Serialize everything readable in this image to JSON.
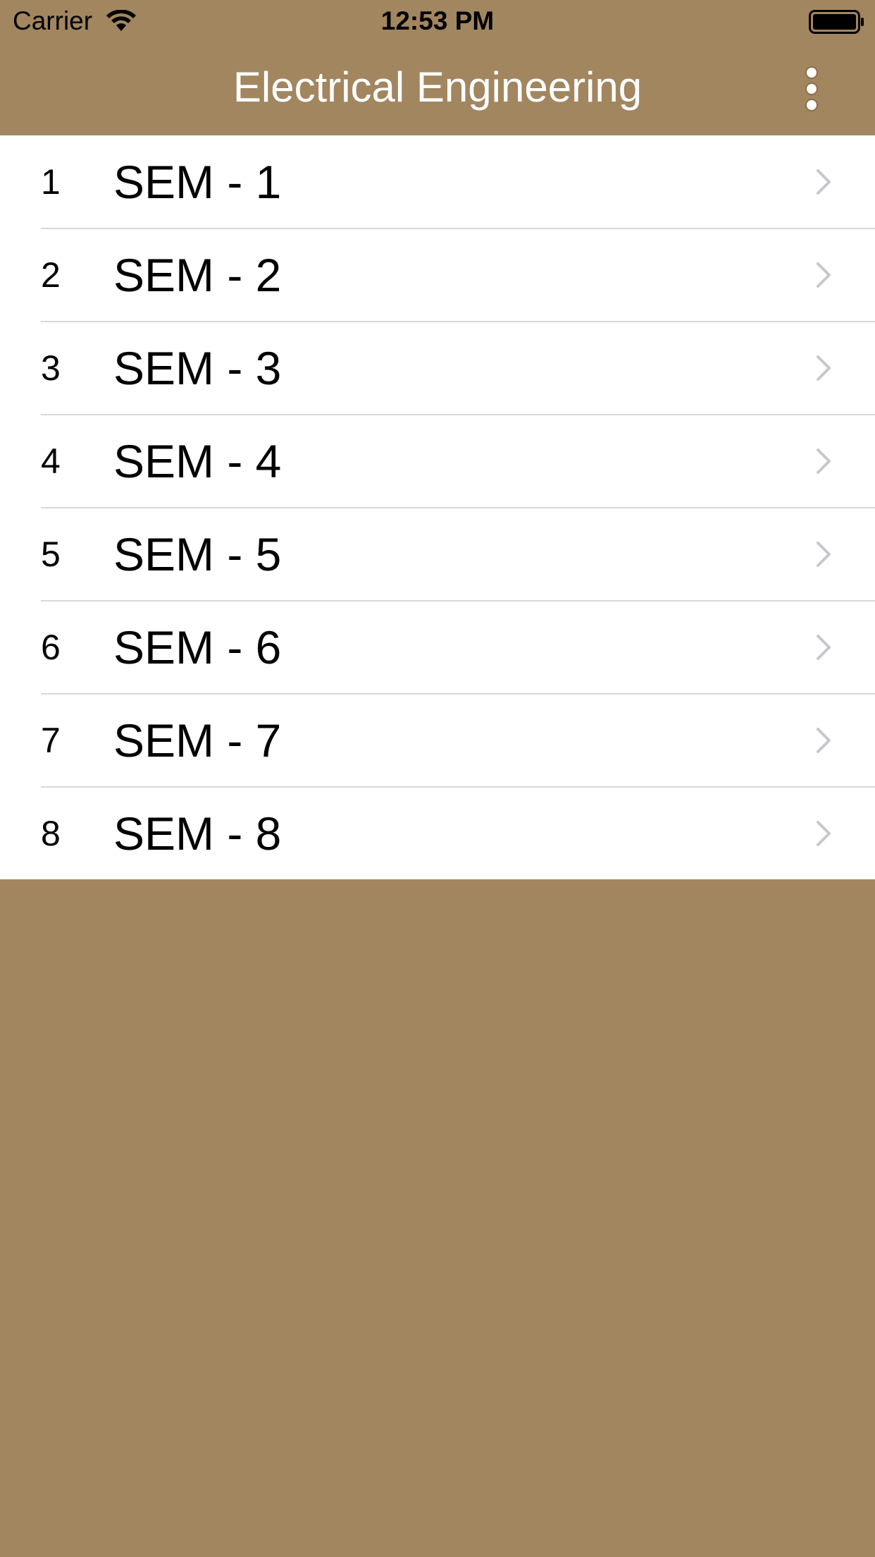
{
  "status_bar": {
    "carrier": "Carrier",
    "time": "12:53 PM",
    "wifi_icon": "wifi-icon",
    "battery_icon": "battery-icon"
  },
  "nav": {
    "title": "Electrical Engineering",
    "more_icon": "more-vertical-icon"
  },
  "colors": {
    "background": "#a2865f",
    "title_text": "#ffffff",
    "chevron": "#c7c7cc",
    "separator": "#d8d8d8"
  },
  "semesters": [
    {
      "number": "1",
      "label": "SEM - 1"
    },
    {
      "number": "2",
      "label": "SEM - 2"
    },
    {
      "number": "3",
      "label": "SEM - 3"
    },
    {
      "number": "4",
      "label": "SEM - 4"
    },
    {
      "number": "5",
      "label": "SEM - 5"
    },
    {
      "number": "6",
      "label": "SEM - 6"
    },
    {
      "number": "7",
      "label": "SEM - 7"
    },
    {
      "number": "8",
      "label": "SEM - 8"
    }
  ]
}
